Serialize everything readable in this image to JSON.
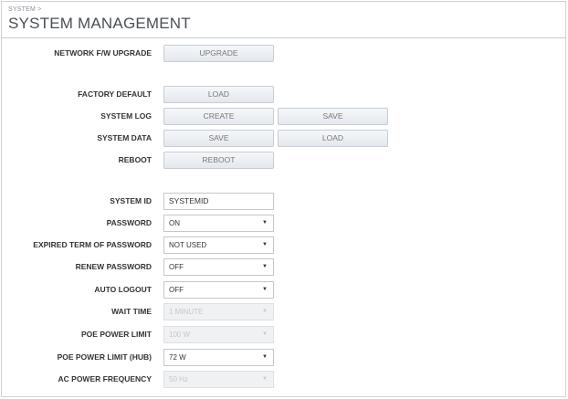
{
  "header": {
    "breadcrumb": "SYSTEM >",
    "title": "SYSTEM MANAGEMENT"
  },
  "actions": {
    "network_fw_upgrade": {
      "label": "NETWORK F/W UPGRADE",
      "button": "UPGRADE"
    },
    "factory_default": {
      "label": "FACTORY DEFAULT",
      "button": "LOAD"
    },
    "system_log": {
      "label": "SYSTEM LOG",
      "button1": "CREATE",
      "button2": "SAVE"
    },
    "system_data": {
      "label": "SYSTEM DATA",
      "button1": "SAVE",
      "button2": "LOAD"
    },
    "reboot": {
      "label": "REBOOT",
      "button": "REBOOT"
    }
  },
  "settings": {
    "system_id": {
      "label": "SYSTEM ID",
      "value": "SYSTEMID"
    },
    "password": {
      "label": "PASSWORD",
      "value": "ON"
    },
    "expired_term": {
      "label": "EXPIRED TERM OF PASSWORD",
      "value": "NOT USED"
    },
    "renew_password": {
      "label": "RENEW PASSWORD",
      "value": "OFF"
    },
    "auto_logout": {
      "label": "AUTO LOGOUT",
      "value": "OFF"
    },
    "wait_time": {
      "label": "WAIT TIME",
      "value": "1 MINUTE"
    },
    "poe_power_limit": {
      "label": "POE POWER LIMIT",
      "value": "100 W"
    },
    "poe_power_limit_hub": {
      "label": "POE POWER LIMIT (HUB)",
      "value": "72 W"
    },
    "ac_power_frequency": {
      "label": "AC POWER FREQUENCY",
      "value": "50 Hz"
    }
  },
  "icons": {
    "dropdown": "chevron-down-icon",
    "dropdown_glyph": "▼"
  }
}
